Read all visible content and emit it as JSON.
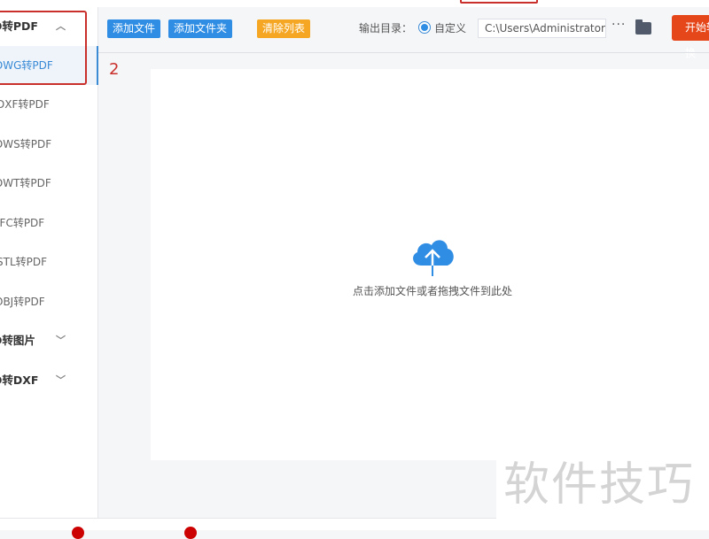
{
  "sidebar": {
    "group_pdf": "D转PDF",
    "items": [
      "DWG转PDF",
      "DXF转PDF",
      "DWS转PDF",
      "DWT转PDF",
      "IFC转PDF",
      "STL转PDF",
      "OBJ转PDF"
    ],
    "group_image": "D转图片",
    "group_dxf": "D转DXF"
  },
  "toolbar": {
    "add_file": "添加文件",
    "add_folder": "添加文件夹",
    "clear_list": "清除列表",
    "output_label": "输出目录：",
    "custom_label": "自定义",
    "output_path": "C:\\Users\\Administrator\\",
    "more": "···",
    "start": "开始转换"
  },
  "annotation_step": "2",
  "drop_text": "点击添加文件或者拖拽文件到此处",
  "watermark": "软件技巧",
  "colors": {
    "accent": "#2f8de4",
    "orange": "#f5a623",
    "start": "#e5461a",
    "annotation": "#c9302c"
  }
}
